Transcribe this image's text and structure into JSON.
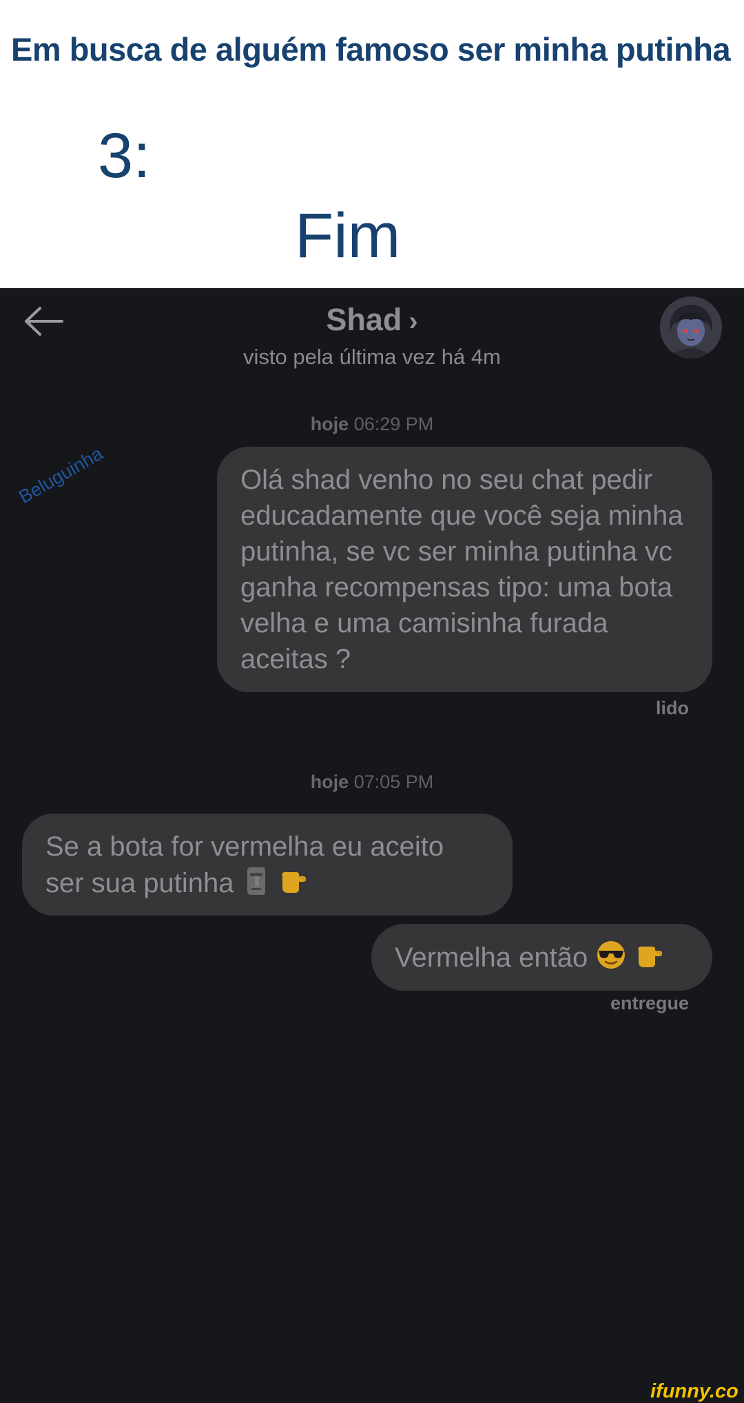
{
  "caption": {
    "line1": "Em busca de alguém famoso ser minha putinha",
    "number": "3:",
    "end": "Fim"
  },
  "chat": {
    "back_icon": "arrow-left-icon",
    "contact_name": "Shad",
    "contact_chevron": "›",
    "last_seen": "visto pela última vez há 4m",
    "avatar_icon": "anime-avatar",
    "watermark": "Beluguinha",
    "messages": [
      {
        "day": "hoje",
        "time": "06:29 PM",
        "direction": "outgoing",
        "text": "Olá shad venho no seu chat pedir educadamente que você seja minha putinha, se vc ser minha putinha vc ganha recompensas tipo: uma bota velha e uma camisinha furada aceitas ?",
        "status": "lido"
      },
      {
        "day": "hoje",
        "time": "07:05 PM",
        "direction": "incoming",
        "text": "Se a bota for vermelha eu aceito ser sua putinha",
        "emojis": [
          "moai-emoji",
          "pointing-hand-emoji"
        ]
      },
      {
        "direction": "outgoing",
        "text": "Vermelha então",
        "emojis": [
          "sunglasses-emoji",
          "pointing-hand-emoji"
        ],
        "status": "entregue"
      }
    ]
  },
  "footer": {
    "logo": "ifunny.co"
  },
  "colors": {
    "caption_text": "#17426f",
    "chat_background": "#16171b",
    "bubble": "#363638",
    "bubble_text": "#8e8e92",
    "watermark": "#1f5fae",
    "logo": "#f4c200"
  }
}
